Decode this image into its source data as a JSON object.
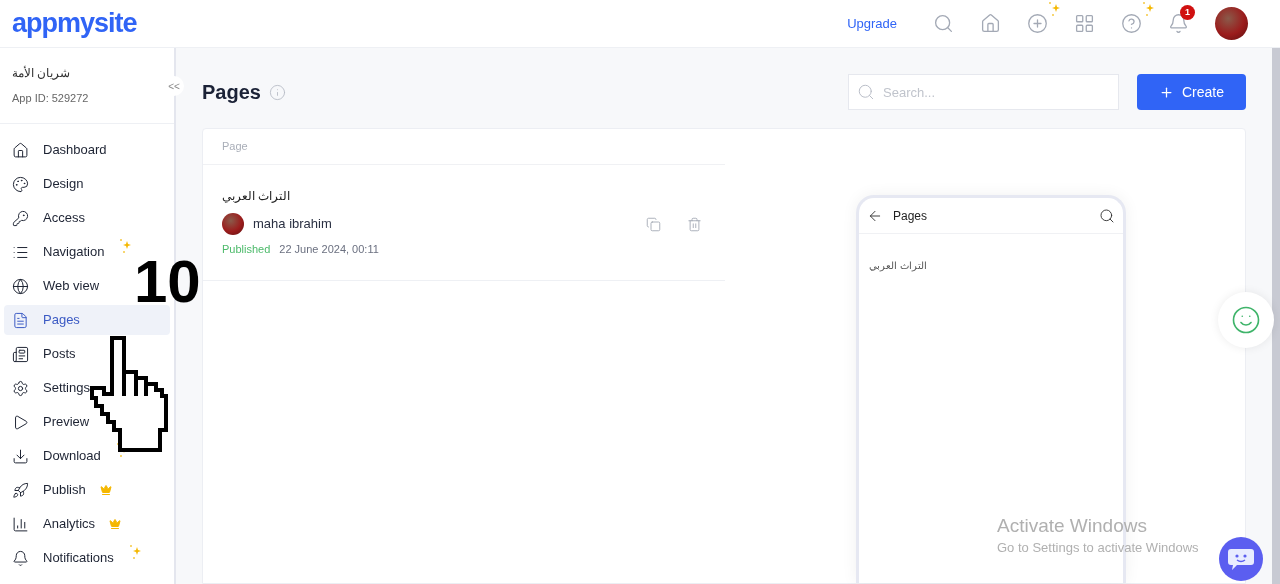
{
  "header": {
    "logo": "appmysite",
    "upgrade": "Upgrade",
    "notification_count": "1"
  },
  "app": {
    "name": "شريان الأمة",
    "app_id": "App ID: 529272",
    "collapse": "<<"
  },
  "sidebar": {
    "items": [
      {
        "label": "Dashboard",
        "kind": "home",
        "sparkle": false,
        "crown": false,
        "selected": false
      },
      {
        "label": "Design",
        "kind": "palette",
        "sparkle": false,
        "crown": false,
        "selected": false
      },
      {
        "label": "Access",
        "kind": "key",
        "sparkle": false,
        "crown": false,
        "selected": false
      },
      {
        "label": "Navigation",
        "kind": "list",
        "sparkle": true,
        "crown": false,
        "selected": false
      },
      {
        "label": "Web view",
        "kind": "globe",
        "sparkle": false,
        "crown": false,
        "selected": false
      },
      {
        "label": "Pages",
        "kind": "file",
        "sparkle": false,
        "crown": false,
        "selected": true
      },
      {
        "label": "Posts",
        "kind": "posts",
        "sparkle": false,
        "crown": false,
        "selected": false
      },
      {
        "label": "Settings",
        "kind": "settings",
        "sparkle": false,
        "crown": false,
        "selected": false
      },
      {
        "label": "Preview",
        "kind": "play",
        "sparkle": false,
        "crown": false,
        "selected": false
      },
      {
        "label": "Download",
        "kind": "download",
        "sparkle": true,
        "crown": false,
        "selected": false
      },
      {
        "label": "Publish",
        "kind": "rocket",
        "sparkle": false,
        "crown": true,
        "selected": false
      },
      {
        "label": "Analytics",
        "kind": "chart",
        "sparkle": false,
        "crown": true,
        "selected": false
      },
      {
        "label": "Notifications",
        "kind": "bell",
        "sparkle": true,
        "crown": false,
        "selected": false
      }
    ]
  },
  "page": {
    "title": "Pages",
    "search": {
      "placeholder": "Search..."
    },
    "create": "Create"
  },
  "table": {
    "column": "Page",
    "rows": [
      {
        "title": "التراث العربي",
        "author": "maha ibrahim",
        "status": "Published",
        "date": "22 June 2024, 00:11"
      }
    ]
  },
  "preview": {
    "title": "Pages",
    "items": [
      "التراث العربي"
    ]
  },
  "annotation": {
    "step": "10"
  },
  "os_notice": {
    "title": "Activate Windows",
    "subtitle": "Go to Settings to activate Windows"
  }
}
